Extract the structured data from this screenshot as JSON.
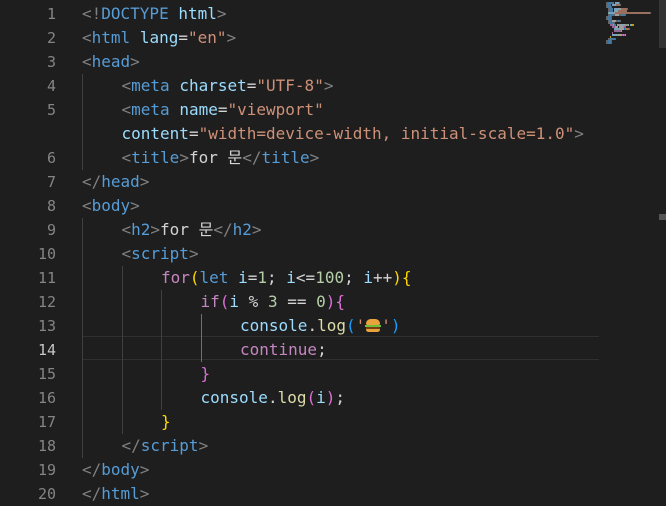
{
  "editor": {
    "language": "html",
    "active_line": 14,
    "lines": [
      {
        "n": 1,
        "indent": 0,
        "tokens": [
          [
            "<!",
            "t-punct"
          ],
          [
            "DOCTYPE",
            "t-tag"
          ],
          [
            " ",
            "t-text"
          ],
          [
            "html",
            "t-attr"
          ],
          [
            ">",
            "t-punct"
          ]
        ]
      },
      {
        "n": 2,
        "indent": 0,
        "tokens": [
          [
            "<",
            "t-punct"
          ],
          [
            "html",
            "t-tag"
          ],
          [
            " ",
            "t-text"
          ],
          [
            "lang",
            "t-attr"
          ],
          [
            "=",
            "t-text"
          ],
          [
            "\"en\"",
            "t-str"
          ],
          [
            ">",
            "t-punct"
          ]
        ]
      },
      {
        "n": 3,
        "indent": 0,
        "tokens": [
          [
            "<",
            "t-punct"
          ],
          [
            "head",
            "t-tag"
          ],
          [
            ">",
            "t-punct"
          ]
        ]
      },
      {
        "n": 4,
        "indent": 1,
        "tokens": [
          [
            "<",
            "t-punct"
          ],
          [
            "meta",
            "t-tag"
          ],
          [
            " ",
            "t-text"
          ],
          [
            "charset",
            "t-attr"
          ],
          [
            "=",
            "t-text"
          ],
          [
            "\"UTF-8\"",
            "t-str"
          ],
          [
            ">",
            "t-punct"
          ]
        ]
      },
      {
        "n": 5,
        "indent": 1,
        "tokens": [
          [
            "<",
            "t-punct"
          ],
          [
            "meta",
            "t-tag"
          ],
          [
            " ",
            "t-text"
          ],
          [
            "name",
            "t-attr"
          ],
          [
            "=",
            "t-text"
          ],
          [
            "\"viewport\"",
            "t-str"
          ]
        ]
      },
      {
        "n": null,
        "indent": 1,
        "tokens": [
          [
            "content",
            "t-attr"
          ],
          [
            "=",
            "t-text"
          ],
          [
            "\"width=device-width, initial-scale=1.0\"",
            "t-str"
          ],
          [
            ">",
            "t-punct"
          ]
        ]
      },
      {
        "n": 6,
        "indent": 1,
        "tokens": [
          [
            "<",
            "t-punct"
          ],
          [
            "title",
            "t-tag"
          ],
          [
            ">",
            "t-punct"
          ],
          [
            "for 문",
            "t-text"
          ],
          [
            "</",
            "t-punct"
          ],
          [
            "title",
            "t-tag"
          ],
          [
            ">",
            "t-punct"
          ]
        ]
      },
      {
        "n": 7,
        "indent": 0,
        "tokens": [
          [
            "</",
            "t-punct"
          ],
          [
            "head",
            "t-tag"
          ],
          [
            ">",
            "t-punct"
          ]
        ]
      },
      {
        "n": 8,
        "indent": 0,
        "tokens": [
          [
            "<",
            "t-punct"
          ],
          [
            "body",
            "t-tag"
          ],
          [
            ">",
            "t-punct"
          ]
        ]
      },
      {
        "n": 9,
        "indent": 1,
        "tokens": [
          [
            "<",
            "t-punct"
          ],
          [
            "h2",
            "t-tag"
          ],
          [
            ">",
            "t-punct"
          ],
          [
            "for 문",
            "t-text"
          ],
          [
            "</",
            "t-punct"
          ],
          [
            "h2",
            "t-tag"
          ],
          [
            ">",
            "t-punct"
          ]
        ]
      },
      {
        "n": 10,
        "indent": 1,
        "tokens": [
          [
            "<",
            "t-punct"
          ],
          [
            "script",
            "t-tag"
          ],
          [
            ">",
            "t-punct"
          ]
        ]
      },
      {
        "n": 11,
        "indent": 2,
        "tokens": [
          [
            "for",
            "t-kw"
          ],
          [
            "(",
            "t-b1"
          ],
          [
            "let",
            "t-decl"
          ],
          [
            " ",
            "t-text"
          ],
          [
            "i",
            "t-var"
          ],
          [
            "=",
            "t-op"
          ],
          [
            "1",
            "t-num"
          ],
          [
            "; ",
            "t-text"
          ],
          [
            "i",
            "t-var"
          ],
          [
            "<=",
            "t-op"
          ],
          [
            "100",
            "t-num"
          ],
          [
            "; ",
            "t-text"
          ],
          [
            "i",
            "t-var"
          ],
          [
            "++",
            "t-op"
          ],
          [
            ")",
            "t-b1"
          ],
          [
            "{",
            "t-b1"
          ]
        ]
      },
      {
        "n": 12,
        "indent": 3,
        "tokens": [
          [
            "if",
            "t-kw"
          ],
          [
            "(",
            "t-b2"
          ],
          [
            "i",
            "t-var"
          ],
          [
            " % ",
            "t-op"
          ],
          [
            "3",
            "t-num"
          ],
          [
            " == ",
            "t-op"
          ],
          [
            "0",
            "t-num"
          ],
          [
            ")",
            "t-b2"
          ],
          [
            "{",
            "t-b2"
          ]
        ]
      },
      {
        "n": 13,
        "indent": 4,
        "tokens": [
          [
            "console",
            "t-var"
          ],
          [
            ".",
            "t-text"
          ],
          [
            "log",
            "t-fn"
          ],
          [
            "(",
            "t-b3"
          ],
          [
            "'",
            "t-str"
          ],
          [
            "🍔",
            "emoji"
          ],
          [
            "'",
            "t-str"
          ],
          [
            ")",
            "t-b3"
          ]
        ]
      },
      {
        "n": 14,
        "indent": 4,
        "tokens": [
          [
            "continue",
            "t-kw"
          ],
          [
            ";",
            "t-text"
          ]
        ]
      },
      {
        "n": 15,
        "indent": 3,
        "tokens": [
          [
            "}",
            "t-b2"
          ]
        ]
      },
      {
        "n": 16,
        "indent": 3,
        "tokens": [
          [
            "console",
            "t-var"
          ],
          [
            ".",
            "t-text"
          ],
          [
            "log",
            "t-fn"
          ],
          [
            "(",
            "t-b2"
          ],
          [
            "i",
            "t-var"
          ],
          [
            ")",
            "t-b2"
          ],
          [
            ";",
            "t-text"
          ]
        ]
      },
      {
        "n": 17,
        "indent": 2,
        "tokens": [
          [
            "}",
            "t-b1"
          ]
        ]
      },
      {
        "n": 18,
        "indent": 1,
        "tokens": [
          [
            "</",
            "t-punct"
          ],
          [
            "script",
            "t-tag"
          ],
          [
            ">",
            "t-punct"
          ]
        ]
      },
      {
        "n": 19,
        "indent": 0,
        "tokens": [
          [
            "</",
            "t-punct"
          ],
          [
            "body",
            "t-tag"
          ],
          [
            ">",
            "t-punct"
          ]
        ]
      },
      {
        "n": 20,
        "indent": 0,
        "tokens": [
          [
            "</",
            "t-punct"
          ],
          [
            "html",
            "t-tag"
          ],
          [
            ">",
            "t-punct"
          ]
        ]
      }
    ]
  },
  "colors": {
    "background": "#1e1e1e",
    "line_number": "#858585",
    "line_number_active": "#c6c6c6",
    "tag": "#569cd6",
    "attribute": "#9cdcfe",
    "string": "#ce9178",
    "keyword": "#c586c0",
    "number": "#b5cea8",
    "function": "#dcdcaa"
  }
}
